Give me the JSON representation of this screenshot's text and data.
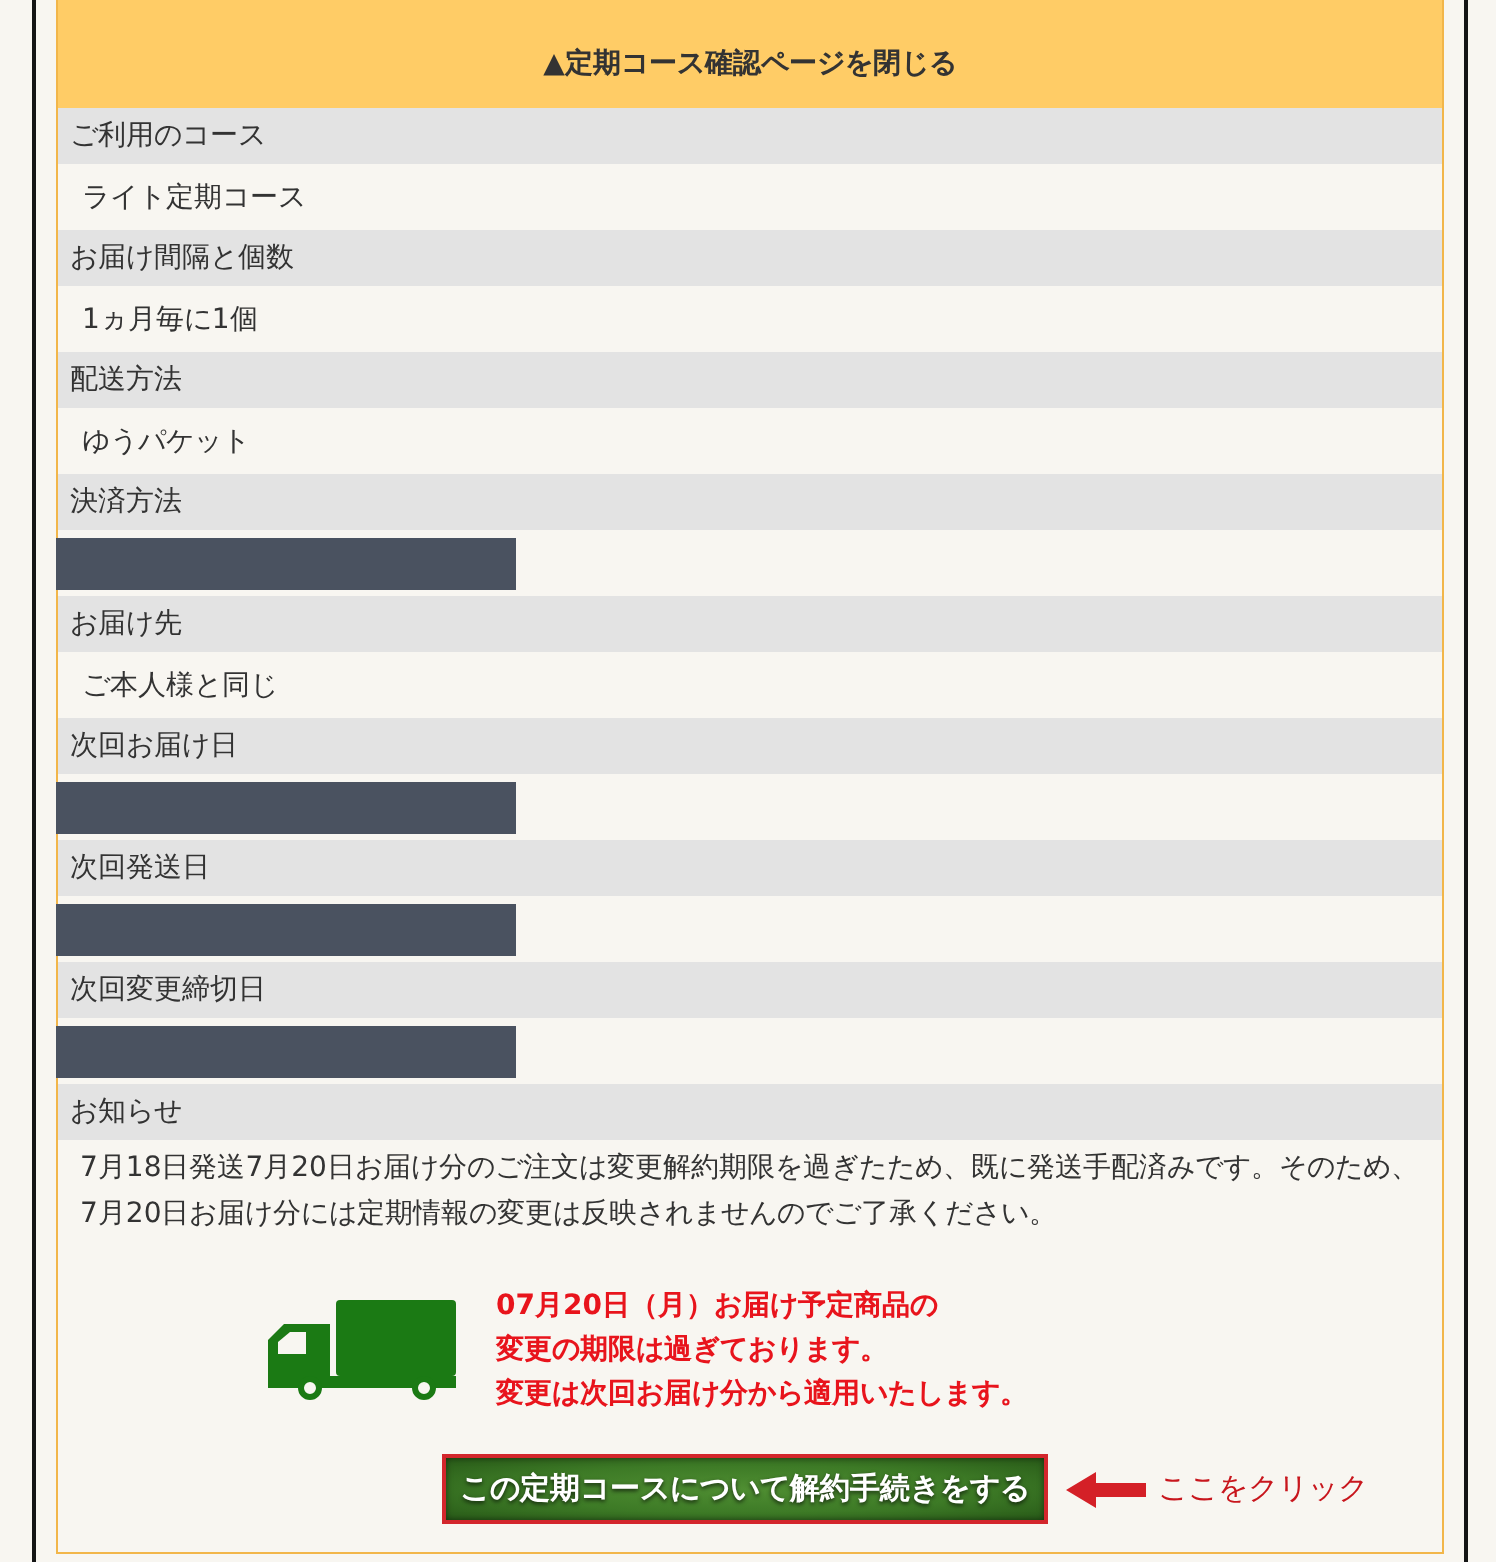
{
  "close_toggle": {
    "label": "▲定期コース確認ページを閉じる"
  },
  "details": [
    {
      "label": "ご利用のコース",
      "value": {
        "kind": "text",
        "text": "ライト定期コース"
      }
    },
    {
      "label": "お届け間隔と個数",
      "value": {
        "kind": "text",
        "text": "1ヵ月毎に1個"
      }
    },
    {
      "label": "配送方法",
      "value": {
        "kind": "text",
        "text": "ゆうパケット"
      }
    },
    {
      "label": "決済方法",
      "value": {
        "kind": "redacted"
      }
    },
    {
      "label": "お届け先",
      "value": {
        "kind": "text",
        "text": "ご本人様と同じ"
      }
    },
    {
      "label": "次回お届け日",
      "value": {
        "kind": "redacted"
      }
    },
    {
      "label": "次回発送日",
      "value": {
        "kind": "redacted"
      }
    },
    {
      "label": "次回変更締切日",
      "value": {
        "kind": "redacted"
      }
    }
  ],
  "notice": {
    "label": "お知らせ",
    "text": "7月18日発送7月20日お届け分のご注文は変更解約期限を過ぎたため、既に発送手配済みです。そのため、7月20日お届け分には定期情報の変更は反映されませんのでご了承ください。"
  },
  "deadline_message": {
    "lines": [
      "07月20日（月）お届け予定商品の",
      "変更の期限は過ぎております。",
      "変更は次回お届け分から適用いたします。"
    ]
  },
  "cancel_button": {
    "label": "この定期コースについて解約手続きをする"
  },
  "click_hint": {
    "text": "ここをクリック"
  }
}
